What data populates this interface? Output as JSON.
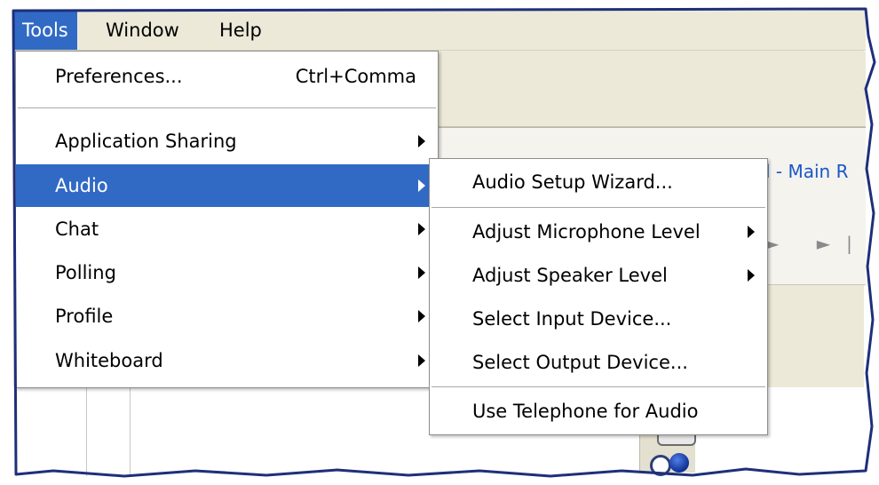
{
  "menubar": {
    "items": [
      {
        "label": "Tools",
        "active": true
      },
      {
        "label": "Window",
        "active": false
      },
      {
        "label": "Help",
        "active": false
      }
    ]
  },
  "tools_menu": {
    "preferences": {
      "label": "Preferences...",
      "shortcut": "Ctrl+Comma"
    },
    "items": [
      {
        "label": "Application Sharing",
        "submenu": true,
        "highlighted": false
      },
      {
        "label": "Audio",
        "submenu": true,
        "highlighted": true
      },
      {
        "label": "Chat",
        "submenu": true,
        "highlighted": false
      },
      {
        "label": "Polling",
        "submenu": true,
        "highlighted": false
      },
      {
        "label": "Profile",
        "submenu": true,
        "highlighted": false
      },
      {
        "label": "Whiteboard",
        "submenu": true,
        "highlighted": false
      }
    ]
  },
  "audio_submenu": {
    "wizard": "Audio Setup Wizard...",
    "items": [
      {
        "label": "Adjust Microphone Level",
        "submenu": true
      },
      {
        "label": "Adjust Speaker Level",
        "submenu": true
      },
      {
        "label": "Select Input Device...",
        "submenu": false
      },
      {
        "label": "Select Output Device...",
        "submenu": false
      }
    ],
    "telephone": "Use Telephone for Audio"
  },
  "background": {
    "room_title": "l - Main R",
    "controls": "► ►|"
  },
  "colors": {
    "highlight": "#316ac5",
    "menubar_bg": "#ece9d8",
    "link_blue": "#1a57c9"
  }
}
